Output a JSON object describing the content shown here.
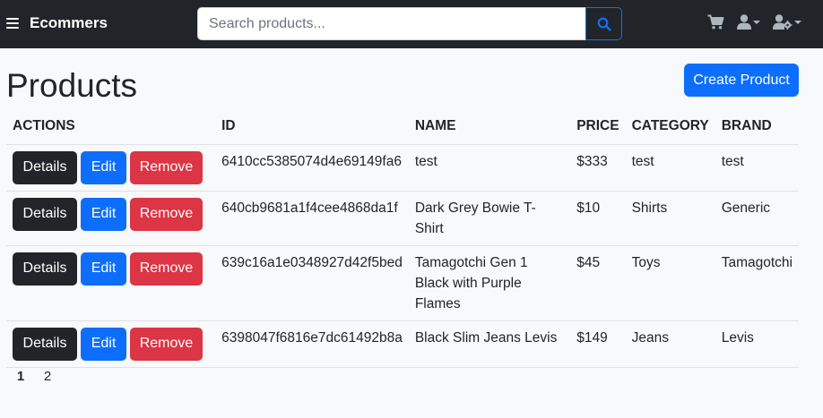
{
  "navbar": {
    "brand": "Ecommers",
    "search_placeholder": "Search products...",
    "icons": [
      "menu-icon",
      "search-icon",
      "cart-icon",
      "user-icon",
      "user-gear-icon"
    ],
    "accent_color": "#0d6efd",
    "background_color": "#212529"
  },
  "main": {
    "title": "Products",
    "create_label": "Create Product"
  },
  "table": {
    "headers": [
      "ACTIONS",
      "ID",
      "NAME",
      "PRICE",
      "CATEGORY",
      "BRAND"
    ],
    "actions": {
      "details": "Details",
      "edit": "Edit",
      "remove": "Remove"
    },
    "rows": [
      {
        "id": "6410cc5385074d4e69149fa6",
        "name": "test",
        "price": "$333",
        "category": "test",
        "brand": "test"
      },
      {
        "id": "640cb9681a1f4cee4868da1f",
        "name": "Dark Grey Bowie T-Shirt",
        "price": "$10",
        "category": "Shirts",
        "brand": "Generic"
      },
      {
        "id": "639c16a1e0348927d42f5bed",
        "name": "Tamagotchi Gen 1 Black with Purple Flames",
        "price": "$45",
        "category": "Toys",
        "brand": "Tamagotchi"
      },
      {
        "id": "6398047f6816e7dc61492b8a",
        "name": "Black Slim Jeans Levis",
        "price": "$149",
        "category": "Jeans",
        "brand": "Levis"
      }
    ]
  },
  "pagination": {
    "pages": [
      "1",
      "2"
    ],
    "active": "1"
  }
}
